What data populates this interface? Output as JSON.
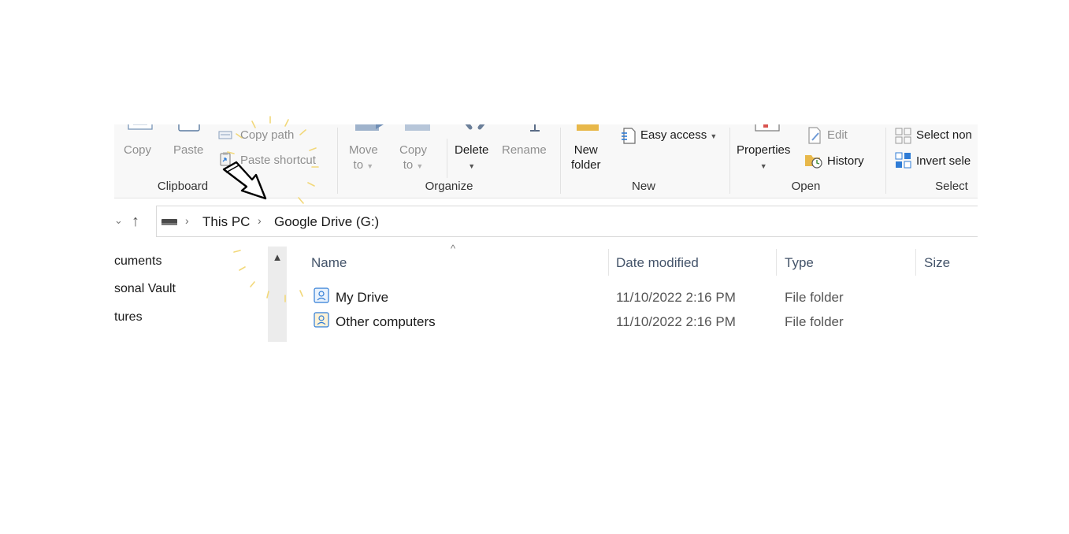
{
  "ribbon": {
    "clipboard": {
      "copy": "Copy",
      "paste": "Paste",
      "copy_path": "Copy path",
      "paste_shortcut": "Paste shortcut",
      "label": "Clipboard"
    },
    "organize": {
      "move_to_line1": "Move",
      "move_to_line2": "to",
      "copy_to_line1": "Copy",
      "copy_to_line2": "to",
      "delete": "Delete",
      "rename": "Rename",
      "label": "Organize"
    },
    "new": {
      "new_folder_line1": "New",
      "new_folder_line2": "folder",
      "easy_access": "Easy access",
      "label": "New"
    },
    "open": {
      "properties": "Properties",
      "edit": "Edit",
      "history": "History",
      "label": "Open"
    },
    "select": {
      "select_none": "Select non",
      "invert_selection": "Invert sele",
      "label": "Select"
    }
  },
  "address": {
    "crumbs": [
      "This PC",
      "Google Drive (G:)"
    ]
  },
  "nav_pane": {
    "items": [
      "cuments",
      "sonal Vault",
      "tures"
    ]
  },
  "file_list": {
    "columns": [
      "Name",
      "Date modified",
      "Type",
      "Size"
    ],
    "rows": [
      {
        "name": "My Drive",
        "date": "11/10/2022 2:16 PM",
        "type": "File folder"
      },
      {
        "name": "Other computers",
        "date": "11/10/2022 2:16 PM",
        "type": "File folder"
      }
    ]
  },
  "colors": {
    "ribbon_bg": "#f8f8f8",
    "accent_blue": "#2f7cd6",
    "folder_yellow": "#e8b84a",
    "annotation_yellow": "#f2d87a"
  }
}
